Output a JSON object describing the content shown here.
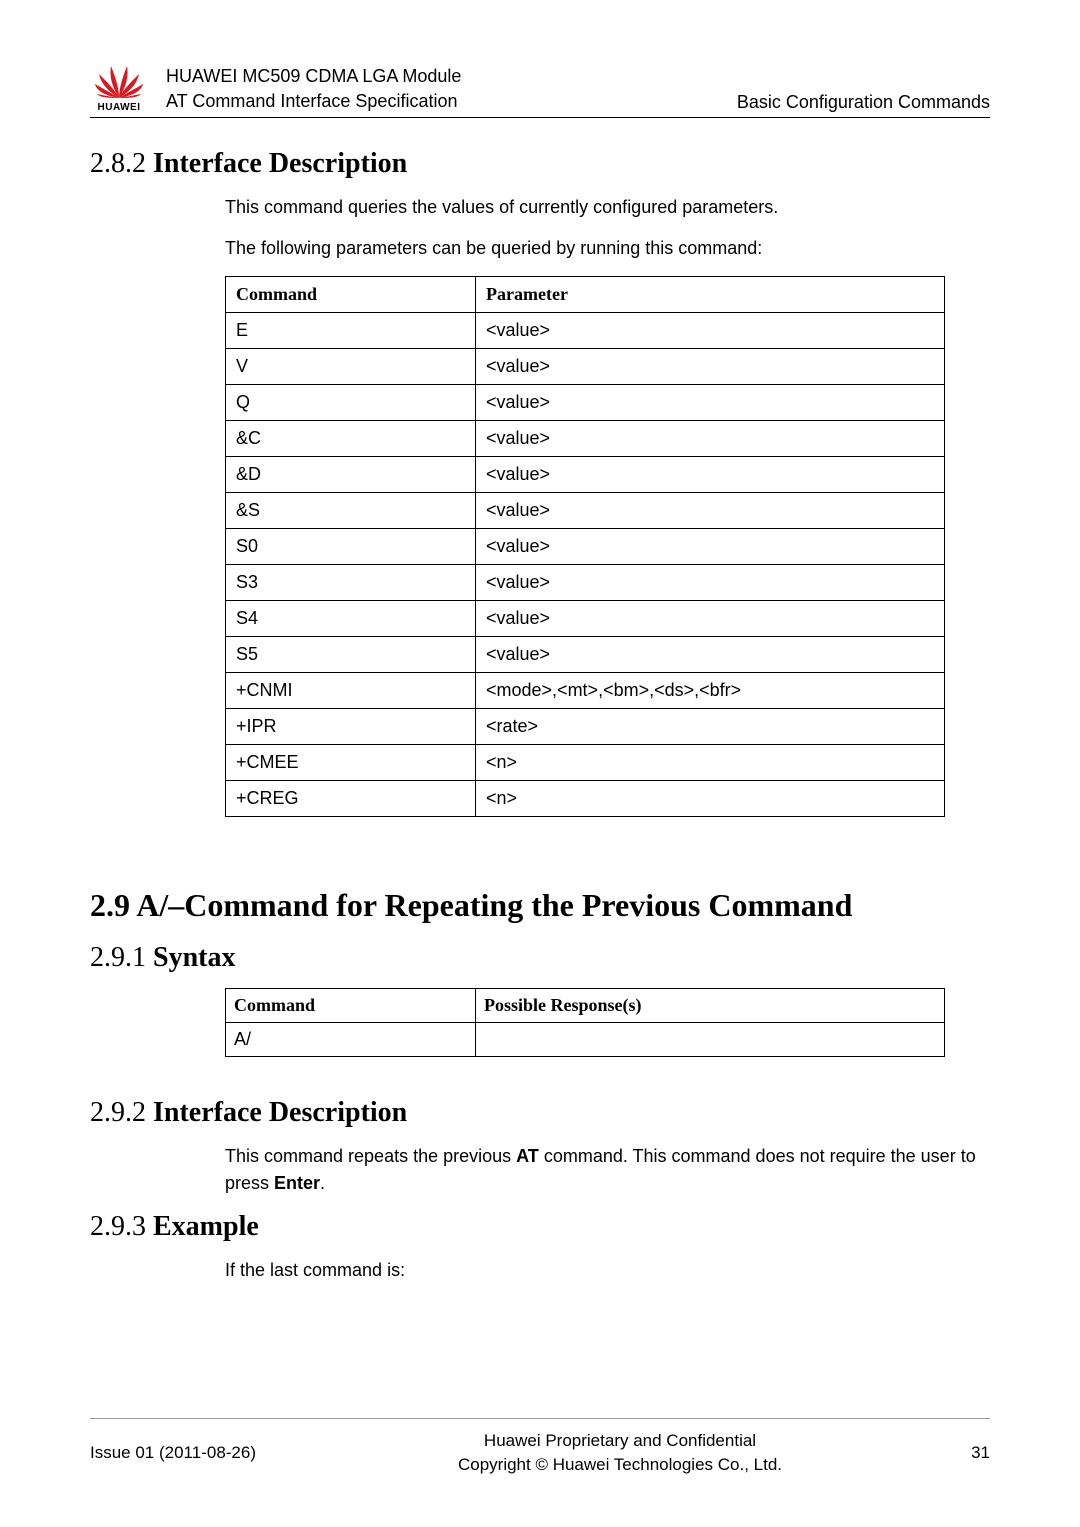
{
  "header": {
    "logo_text": "HUAWEI",
    "title1": "HUAWEI MC509 CDMA LGA Module",
    "title2": "AT Command Interface Specification",
    "right": "Basic Configuration Commands"
  },
  "sec282": {
    "num": "2.8.2 ",
    "title": "Interface Description",
    "p1": "This command queries the values of currently configured parameters.",
    "p2": "The following parameters can be queried by running this command:"
  },
  "table282": {
    "th1": "Command",
    "th2": "Parameter",
    "rows": [
      {
        "c": "E",
        "p": "<value>"
      },
      {
        "c": "V",
        "p": "<value>"
      },
      {
        "c": "Q",
        "p": "<value>"
      },
      {
        "c": "&C",
        "p": "<value>"
      },
      {
        "c": "&D",
        "p": "<value>"
      },
      {
        "c": "&S",
        "p": "<value>"
      },
      {
        "c": "S0",
        "p": "<value>"
      },
      {
        "c": "S3",
        "p": "<value>"
      },
      {
        "c": "S4",
        "p": "<value>"
      },
      {
        "c": "S5",
        "p": "<value>"
      },
      {
        "c": "+CNMI",
        "p": "<mode>,<mt>,<bm>,<ds>,<bfr>"
      },
      {
        "c": "+IPR",
        "p": "<rate>"
      },
      {
        "c": "+CMEE",
        "p": "<n>"
      },
      {
        "c": "+CREG",
        "p": "<n>"
      }
    ]
  },
  "sec29": {
    "title": "2.9 A/–Command for Repeating the Previous Command"
  },
  "sec291": {
    "num": "2.9.1 ",
    "title": "Syntax"
  },
  "table291": {
    "th1": "Command",
    "th2": "Possible Response(s)",
    "row": {
      "c": "A/",
      "p": ""
    }
  },
  "sec292": {
    "num": "2.9.2 ",
    "title": "Interface Description",
    "p_pre": "This command repeats the previous ",
    "p_b1": "AT",
    "p_mid": " command. This command does not require the user to press ",
    "p_b2": "Enter",
    "p_post": "."
  },
  "sec293": {
    "num": "2.9.3 ",
    "title": "Example",
    "p1": "If the last command is:"
  },
  "footer": {
    "issue": "Issue 01 (2011-08-26)",
    "line1": "Huawei Proprietary and Confidential",
    "line2": "Copyright © Huawei Technologies Co., Ltd.",
    "page": "31"
  }
}
